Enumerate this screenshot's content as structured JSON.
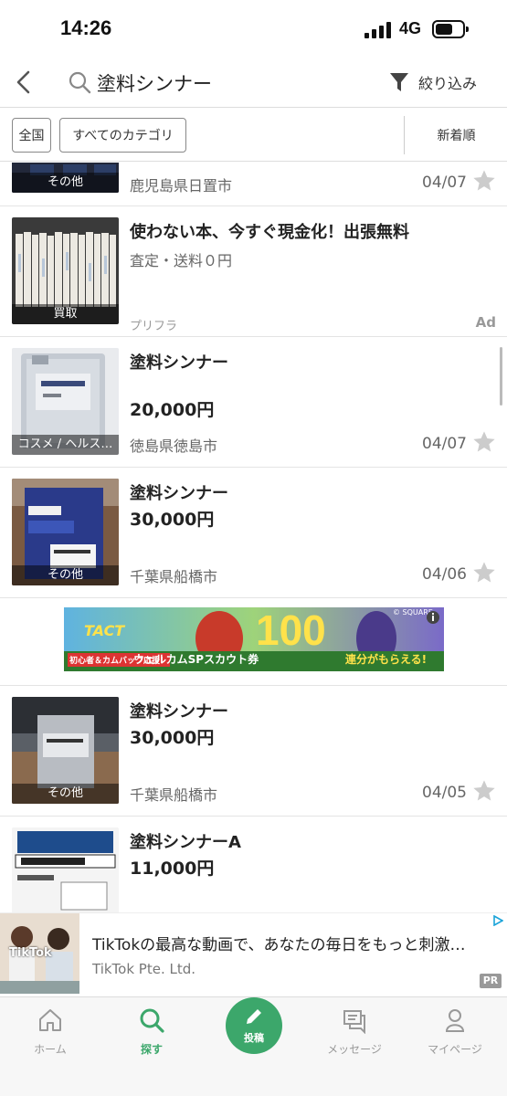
{
  "status": {
    "time": "14:26",
    "network": "4G"
  },
  "header": {
    "query": "塗料シンナー",
    "filter_label": "絞り込み"
  },
  "chips": {
    "region": "全国",
    "category": "すべてのカテゴリ",
    "sort": "新着順"
  },
  "items": [
    {
      "category": "その他",
      "location": "鹿児島県日置市",
      "date": "04/07"
    },
    {
      "title": "使わない本、今すぐ現金化！出張無料",
      "subtitle": "査定・送料０円",
      "category": "買取",
      "advertiser": "プリフラ",
      "ad_label": "Ad"
    },
    {
      "title": "塗料シンナー",
      "price": "20,000円",
      "category": "コスメ / ヘルス…",
      "location": "徳島県徳島市",
      "date": "04/07"
    },
    {
      "title": "塗料シンナー",
      "price": "30,000円",
      "category": "その他",
      "location": "千葉県船橋市",
      "date": "04/06"
    },
    {
      "title": "塗料シンナー",
      "price": "30,000円",
      "category": "その他",
      "location": "千葉県船橋市",
      "date": "04/05"
    },
    {
      "title": "塗料シンナーA",
      "price": "11,000円"
    }
  ],
  "banner": {
    "brand": "TACT",
    "headline": "100",
    "sub": "連分がもらえる!",
    "scout": "ウェルカムSPスカウト券",
    "campaign": "初心者＆カムバック応援！",
    "corner": "© SQUARE"
  },
  "tiktok_ad": {
    "title": "TikTokの最高な動画で、あなたの毎日をもっと刺激…",
    "advertiser": "TikTok Pte. Ltd.",
    "pr": "PR",
    "logo": "TikTok"
  },
  "nav": {
    "home": "ホーム",
    "search": "探す",
    "post": "投稿",
    "message": "メッセージ",
    "mypage": "マイページ"
  },
  "colors": {
    "accent": "#3ca76b",
    "text": "#222222"
  }
}
